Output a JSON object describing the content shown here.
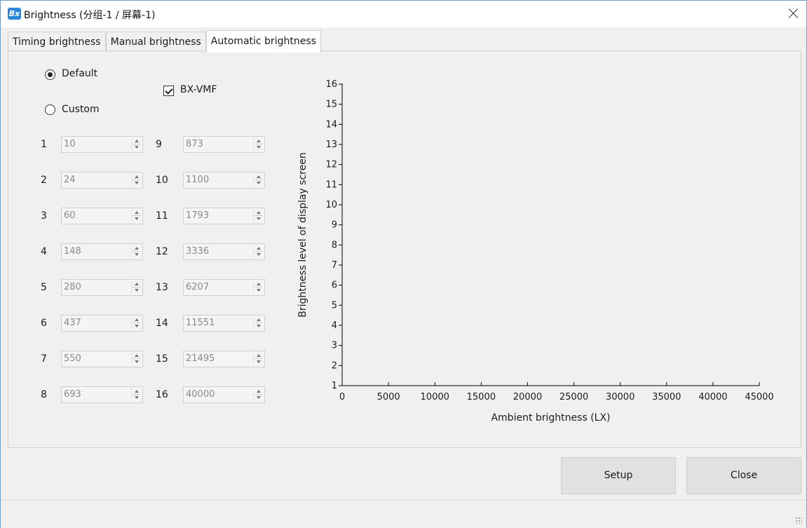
{
  "window": {
    "app_icon_text": "Bx",
    "title": "Brightness  (分组-1 / 屏幕-1)"
  },
  "tabs": [
    {
      "label": "Timing brightness",
      "active": false
    },
    {
      "label": "Manual brightness",
      "active": false
    },
    {
      "label": "Automatic brightness",
      "active": true
    }
  ],
  "mode": {
    "default_label": "Default",
    "custom_label": "Custom",
    "selected": "Default"
  },
  "bx_vmf": {
    "label": "BX-VMF",
    "checked": true
  },
  "levels_left": [
    {
      "n": "1",
      "value": "10"
    },
    {
      "n": "2",
      "value": "24"
    },
    {
      "n": "3",
      "value": "60"
    },
    {
      "n": "4",
      "value": "148"
    },
    {
      "n": "5",
      "value": "280"
    },
    {
      "n": "6",
      "value": "437"
    },
    {
      "n": "7",
      "value": "550"
    },
    {
      "n": "8",
      "value": "693"
    }
  ],
  "levels_right": [
    {
      "n": "9",
      "value": "873"
    },
    {
      "n": "10",
      "value": "1100"
    },
    {
      "n": "11",
      "value": "1793"
    },
    {
      "n": "12",
      "value": "3336"
    },
    {
      "n": "13",
      "value": "6207"
    },
    {
      "n": "14",
      "value": "11551"
    },
    {
      "n": "15",
      "value": "21495"
    },
    {
      "n": "16",
      "value": "40000"
    }
  ],
  "chart_data": {
    "type": "line",
    "title": "",
    "xlabel": "Ambient brightness (LX)",
    "ylabel": "Brightness level of display screen",
    "xlim": [
      0,
      45000
    ],
    "ylim": [
      1,
      16
    ],
    "x_ticks": [
      "0",
      "5000",
      "10000",
      "15000",
      "20000",
      "25000",
      "30000",
      "35000",
      "40000",
      "45000"
    ],
    "y_ticks": [
      "1",
      "2",
      "3",
      "4",
      "5",
      "6",
      "7",
      "8",
      "9",
      "10",
      "11",
      "12",
      "13",
      "14",
      "15",
      "16"
    ],
    "grid": false,
    "series": []
  },
  "buttons": {
    "setup": "Setup",
    "close": "Close"
  }
}
